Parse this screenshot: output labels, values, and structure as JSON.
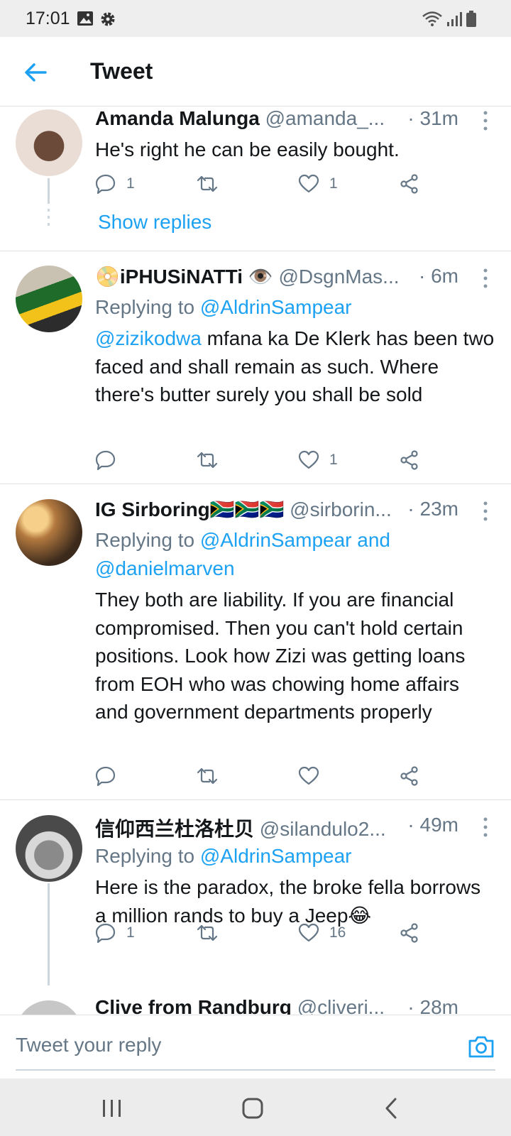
{
  "status_bar": {
    "time": "17:01",
    "left_icons": [
      "gallery-icon",
      "settings-gear-icon"
    ],
    "right_icons": [
      "wifi-icon",
      "signal-icon",
      "battery-icon"
    ]
  },
  "header": {
    "back_icon": "arrow-left-icon",
    "title": "Tweet"
  },
  "tweets": [
    {
      "name": "Amanda Malunga",
      "handle": "@amanda_...",
      "time": "· 31m",
      "text": "He's right he can be easily bought.",
      "reply_count": "1",
      "retweet_count": "",
      "like_count": "1",
      "show_replies": "Show replies"
    },
    {
      "name": "📀iPHUSiNATTi 👁️",
      "handle": "@DsgnMas...",
      "time": "· 6m",
      "replying_prefix": "Replying to",
      "replying_to": "@AldrinSampear",
      "mention": "@zizikodwa",
      "text": " mfana ka De Klerk has been two faced and shall remain as such. Where there's butter surely you shall be sold",
      "reply_count": "",
      "retweet_count": "",
      "like_count": "1"
    },
    {
      "name": "IG Sirboring🇿🇦🇿🇦🇿🇦",
      "handle": "@sirborin...",
      "time": "· 23m",
      "replying_prefix": "Replying to",
      "replying_to": "@AldrinSampear and",
      "replying_to_2": "@danielmarven",
      "text": "They both are liability. If you are financial compromised. Then you can't hold certain positions. Look how Zizi was getting loans from EOH who was chowing home affairs and government departments properly",
      "reply_count": "",
      "retweet_count": "",
      "like_count": ""
    },
    {
      "name": "信仰西兰杜洛杜贝",
      "handle": "@silandulo2...",
      "time": "· 49m",
      "replying_prefix": "Replying to",
      "replying_to": "@AldrinSampear",
      "text": "Here is the paradox, the broke fella borrows a million rands to buy a Jeep😂",
      "reply_count": "1",
      "retweet_count": "",
      "like_count": "16"
    },
    {
      "name": "Clive from Randburg",
      "handle": "@cliveri...",
      "time": "· 28m"
    }
  ],
  "composer": {
    "placeholder": "Tweet your reply",
    "camera_icon": "camera-icon"
  },
  "nav_bar": {
    "icons": [
      "recent-apps-icon",
      "home-icon",
      "back-icon"
    ]
  },
  "colors": {
    "accent": "#1da1f2",
    "text": "#14171a",
    "secondary": "#657786",
    "divider": "#dfe3e6"
  }
}
